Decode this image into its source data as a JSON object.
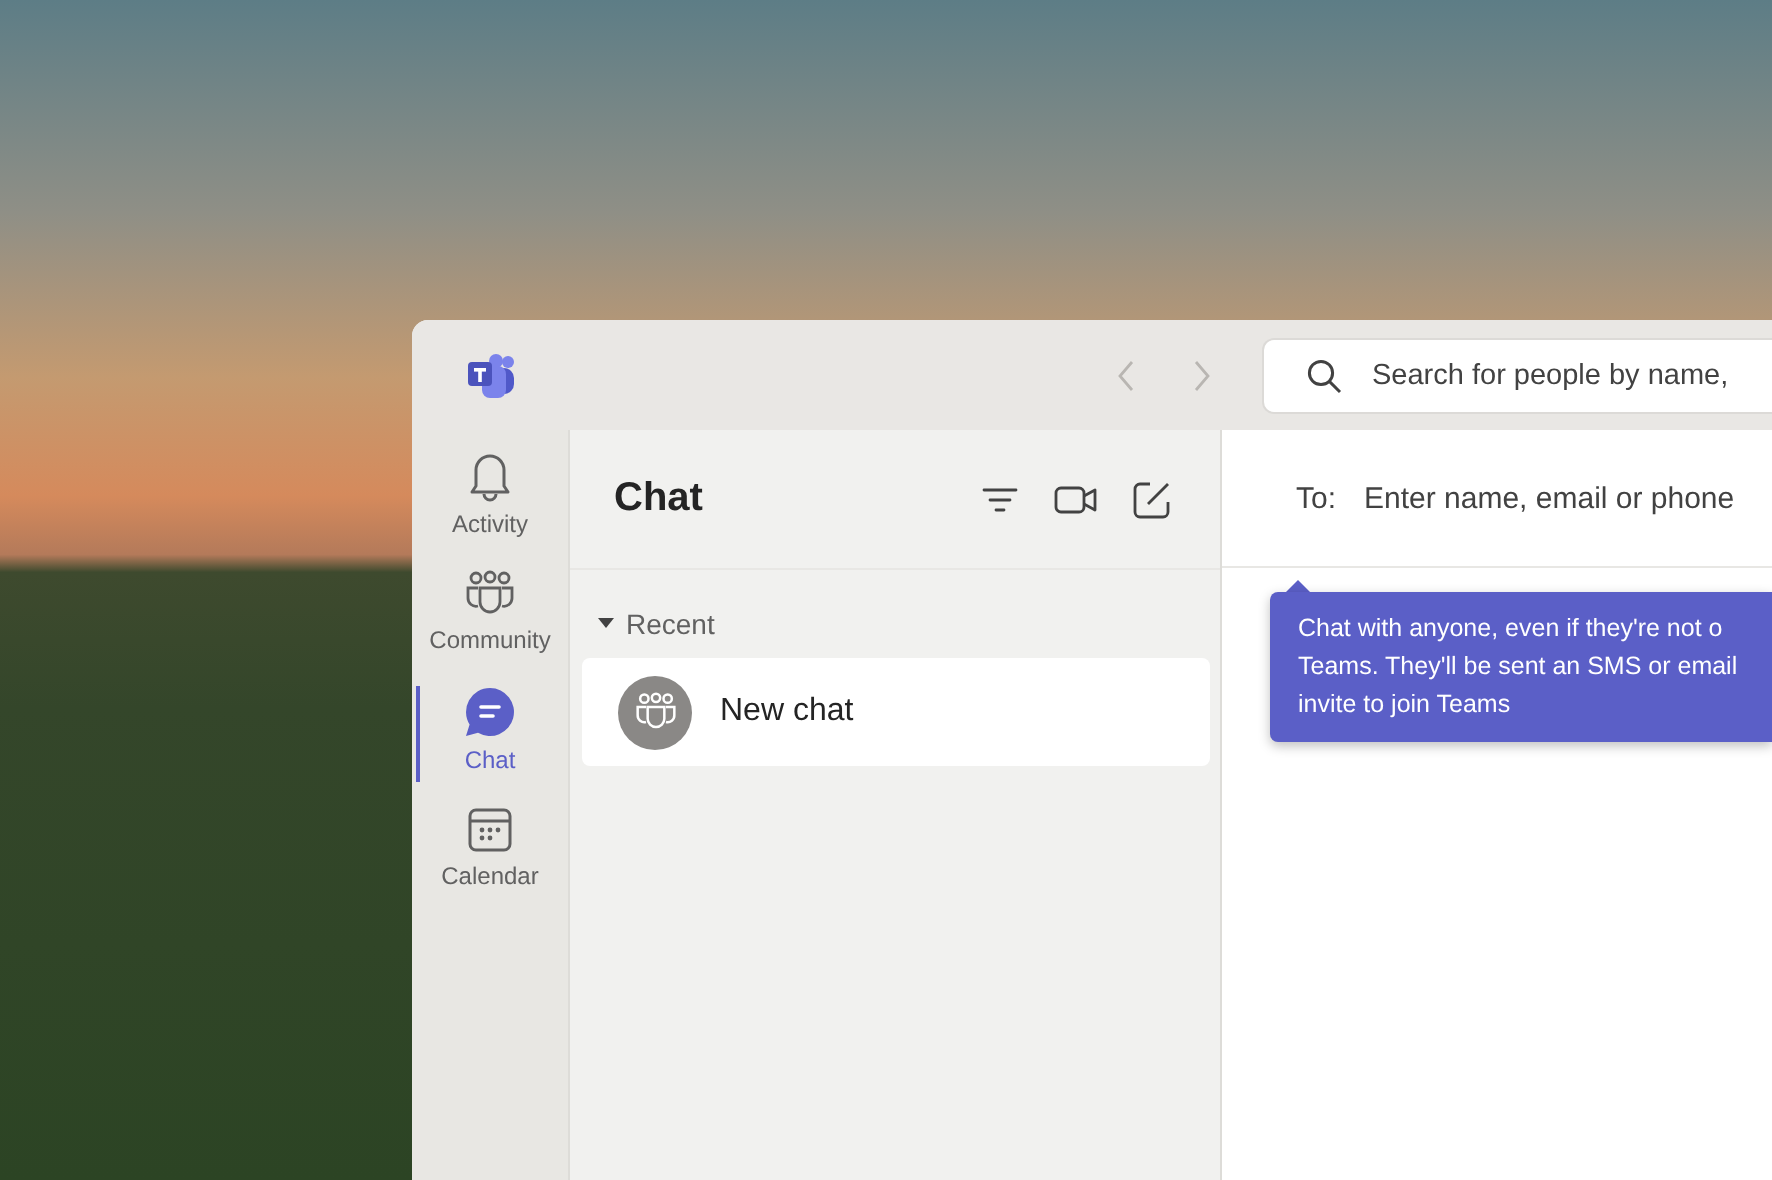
{
  "titlebar": {
    "search": {
      "placeholder": "Search for people by name,"
    }
  },
  "rail": [
    {
      "label": "Activity",
      "selected": false
    },
    {
      "label": "Community",
      "selected": false
    },
    {
      "label": "Chat",
      "selected": true
    },
    {
      "label": "Calendar",
      "selected": false
    }
  ],
  "chat_list": {
    "title": "Chat",
    "sections": [
      {
        "label": "Recent",
        "expanded": true,
        "items": [
          {
            "name": "New chat",
            "selected": true
          }
        ]
      }
    ]
  },
  "compose": {
    "to_label": "To:",
    "to_field": {
      "placeholder": "Enter name, email or phone"
    },
    "tooltip": {
      "lines": [
        "Chat with anyone, even if they're not o",
        "Teams. They'll be sent an SMS or email",
        "invite to join Teams"
      ]
    }
  }
}
